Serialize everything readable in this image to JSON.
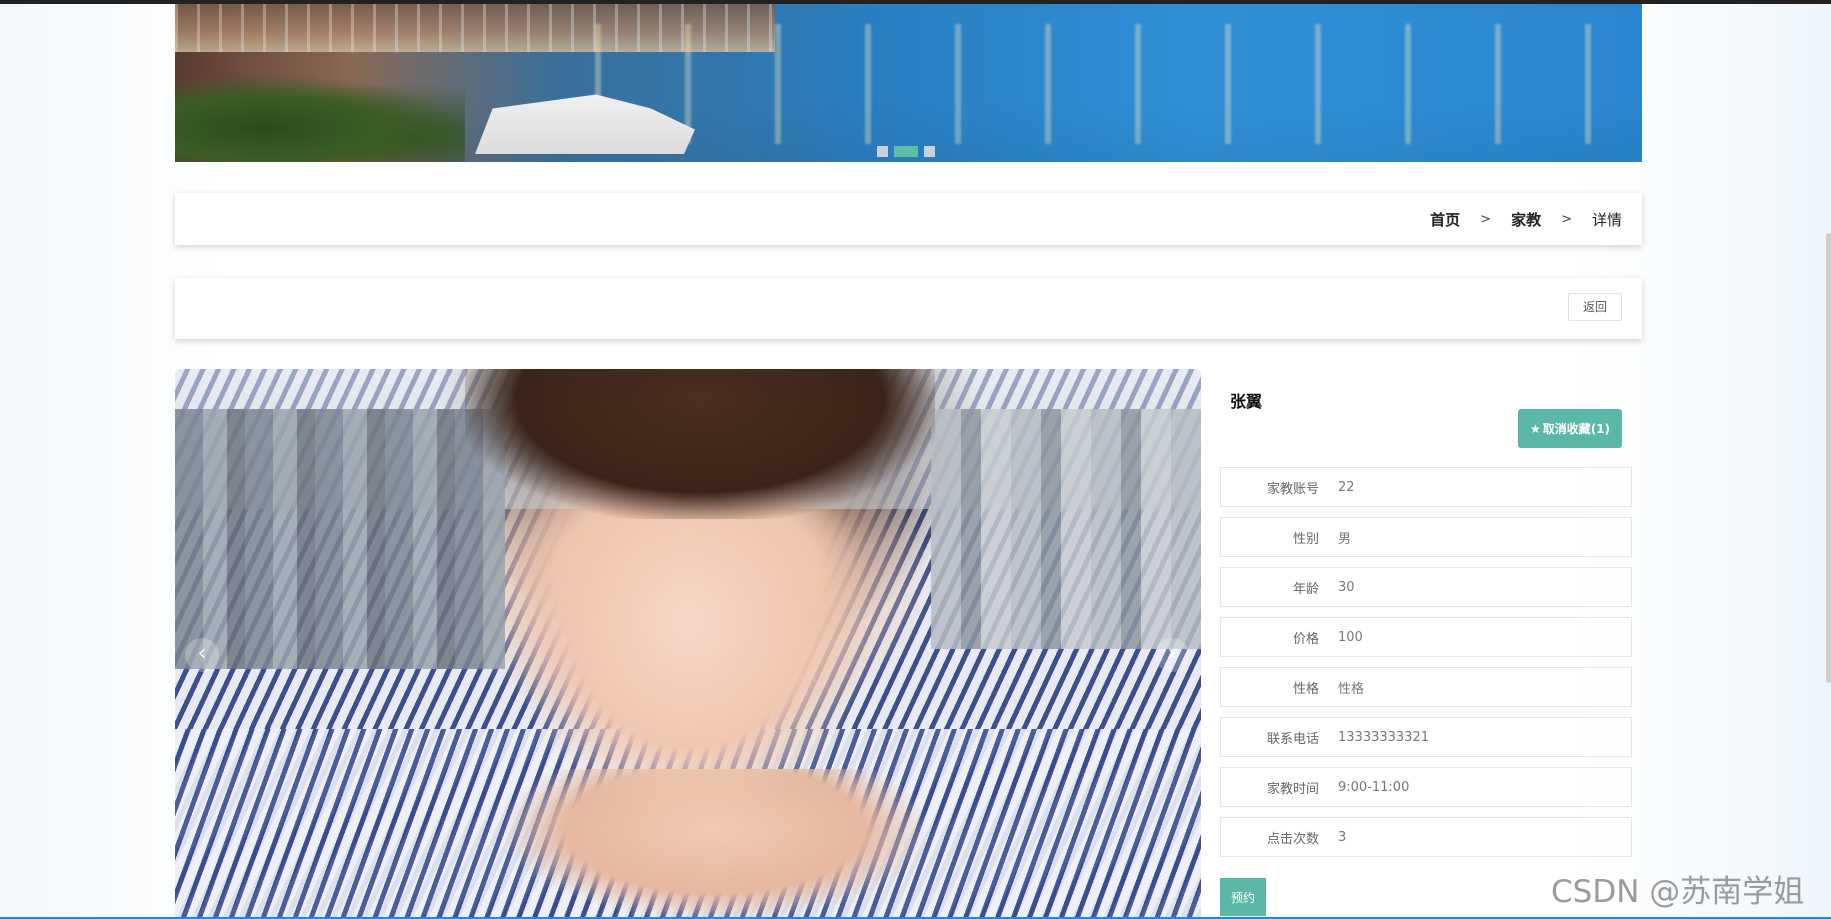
{
  "banner": {
    "active_slide": 2,
    "slide_count": 3
  },
  "breadcrumb": {
    "home": "首页",
    "category": "家教",
    "current": "详情",
    "separator": ">"
  },
  "actions": {
    "back": "返回"
  },
  "tutor": {
    "name": "张翼",
    "favorite_label": "取消收藏(1)",
    "favorite_icon": "star-icon",
    "fields": [
      {
        "label": "家教账号",
        "value": "22"
      },
      {
        "label": "性别",
        "value": "男"
      },
      {
        "label": "年龄",
        "value": "30"
      },
      {
        "label": "价格",
        "value": "100"
      },
      {
        "label": "性格",
        "value": "性格"
      },
      {
        "label": "联系电话",
        "value": "13333333321"
      },
      {
        "label": "家教时间",
        "value": "9:00-11:00"
      },
      {
        "label": "点击次数",
        "value": "3"
      }
    ],
    "book_label": "预约"
  },
  "carousel": {
    "prev_glyph": "‹",
    "next_glyph": "›"
  },
  "watermark": "CSDN @苏南学姐",
  "colors": {
    "accent": "#5bb7a7",
    "dot_active": "#5bbfa6"
  }
}
